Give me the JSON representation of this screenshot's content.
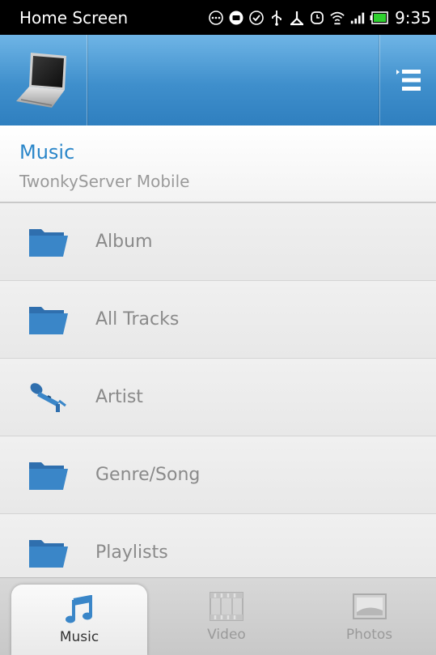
{
  "status_bar": {
    "title": "Home Screen",
    "time": "9:35",
    "icons": [
      "more-icon",
      "message-icon",
      "check-circle-icon",
      "usb-icon",
      "debug-icon",
      "alarm-icon",
      "wifi-icon",
      "signal-icon",
      "battery-icon"
    ]
  },
  "action_bar": {
    "device_icon": "laptop-icon",
    "menu_icon": "list-menu-icon"
  },
  "header": {
    "title": "Music",
    "subtitle": "TwonkyServer Mobile"
  },
  "list": {
    "items": [
      {
        "label": "Album",
        "icon": "folder-icon"
      },
      {
        "label": "All Tracks",
        "icon": "folder-icon"
      },
      {
        "label": "Artist",
        "icon": "microphone-icon"
      },
      {
        "label": "Genre/Song",
        "icon": "folder-icon"
      },
      {
        "label": "Playlists",
        "icon": "folder-icon"
      }
    ]
  },
  "tabs": [
    {
      "label": "Music",
      "icon": "music-note-icon",
      "active": true
    },
    {
      "label": "Video",
      "icon": "film-icon",
      "active": false
    },
    {
      "label": "Photos",
      "icon": "photo-icon",
      "active": false
    }
  ],
  "colors": {
    "accent": "#2a86c9",
    "action_bar": "#3f8fcc",
    "icon_blue": "#3a7fc0"
  }
}
